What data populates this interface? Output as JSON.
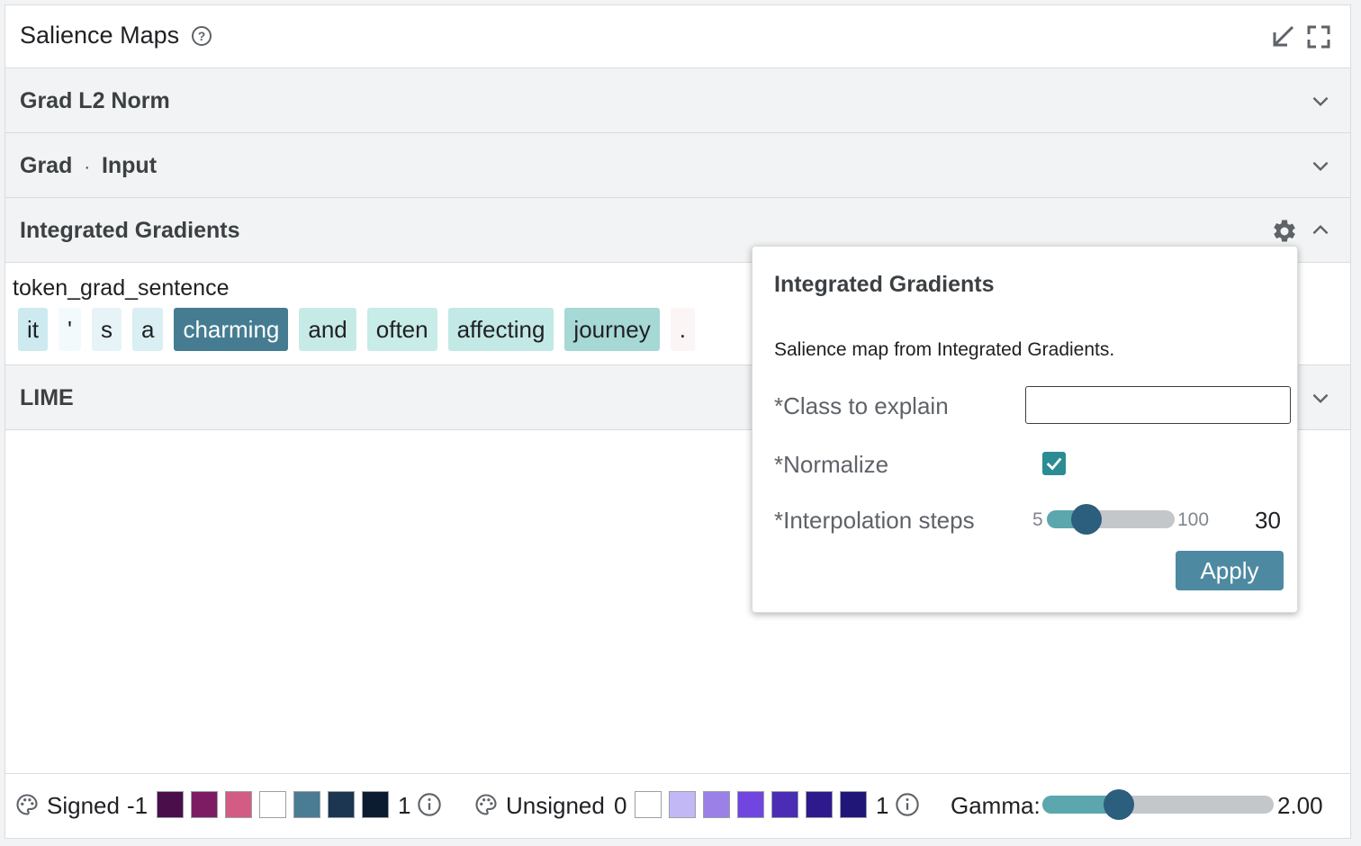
{
  "module": {
    "title": "Salience Maps",
    "help_icon": "help-circle-icon",
    "minimize_icon": "arrow-down-left-icon",
    "fullscreen_icon": "fullscreen-icon"
  },
  "sections": [
    {
      "title": "Grad L2 Norm",
      "expanded": false
    },
    {
      "title_a": "Grad",
      "title_dot": "·",
      "title_b": "Input",
      "expanded": false
    },
    {
      "title": "Integrated Gradients",
      "expanded": true
    },
    {
      "title": "LIME",
      "expanded": false
    }
  ],
  "ig_result": {
    "field_name": "token_grad_sentence",
    "tokens": [
      {
        "text": "it",
        "bg": "#cdeaf0",
        "fg": "#202124"
      },
      {
        "text": "'",
        "bg": "#f3fafb",
        "fg": "#202124"
      },
      {
        "text": "s",
        "bg": "#e6f4f7",
        "fg": "#202124"
      },
      {
        "text": "a",
        "bg": "#d9eff3",
        "fg": "#202124"
      },
      {
        "text": "charming",
        "bg": "#457c92",
        "fg": "#ffffff"
      },
      {
        "text": "and",
        "bg": "#c6ebe7",
        "fg": "#202124"
      },
      {
        "text": "often",
        "bg": "#c8ece8",
        "fg": "#202124"
      },
      {
        "text": "affecting",
        "bg": "#c2e9e5",
        "fg": "#202124"
      },
      {
        "text": "journey",
        "bg": "#a6d8d5",
        "fg": "#202124"
      },
      {
        "text": ".",
        "bg": "#fbf5f6",
        "fg": "#202124"
      }
    ]
  },
  "popup": {
    "title": "Integrated Gradients",
    "description": "Salience map from Integrated Gradients.",
    "class_label": "*Class to explain",
    "class_value": "",
    "normalize_label": "*Normalize",
    "normalize_checked": true,
    "steps_label": "*Interpolation steps",
    "steps_min": "5",
    "steps_max": "100",
    "steps_value": "30",
    "apply_label": "Apply"
  },
  "footer": {
    "signed_label": "Signed",
    "signed_min": "-1",
    "signed_max": "1",
    "signed_colors": [
      "#4a0e4a",
      "#7e1c63",
      "#d35c85",
      "#ffffff",
      "#4a7c94",
      "#1c3550",
      "#0c1c30"
    ],
    "unsigned_label": "Unsigned",
    "unsigned_min": "0",
    "unsigned_max": "1",
    "unsigned_colors": [
      "#ffffff",
      "#c2b8f5",
      "#9b80e8",
      "#7145e0",
      "#4a2cb5",
      "#2e1a8c",
      "#1f1678"
    ],
    "gamma_label": "Gamma:",
    "gamma_value": "2.00",
    "palette_icon": "palette-icon",
    "info_icon": "info-icon"
  }
}
